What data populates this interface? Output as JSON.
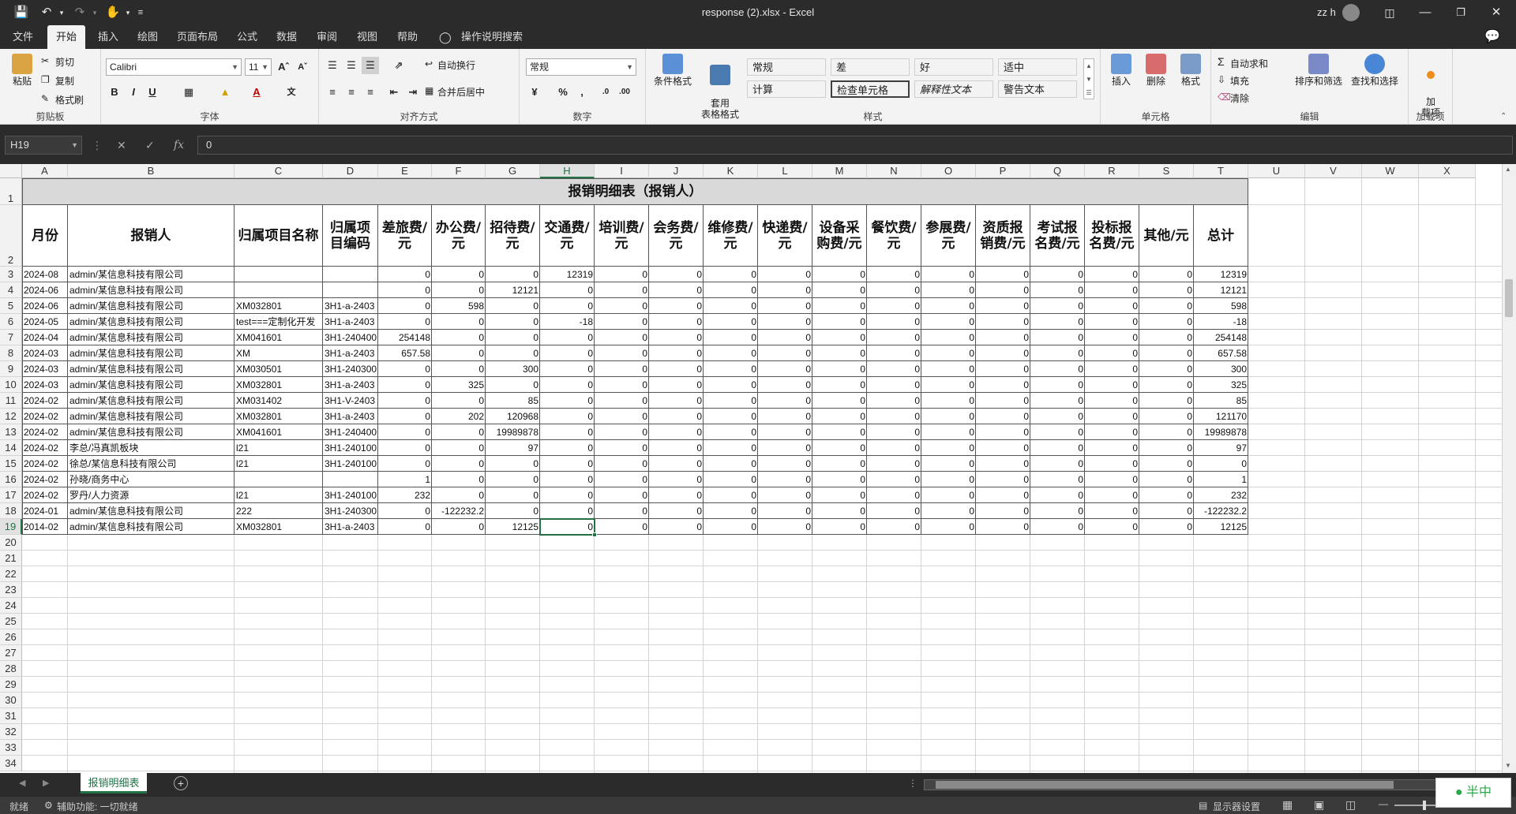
{
  "titlebar": {
    "doc_title": "response (2).xlsx  -  Excel",
    "user": "zz h"
  },
  "tabs": [
    "文件",
    "开始",
    "插入",
    "绘图",
    "页面布局",
    "公式",
    "数据",
    "审阅",
    "视图",
    "帮助"
  ],
  "tell_me": "操作说明搜索",
  "ribbon": {
    "clipboard": {
      "paste": "粘贴",
      "cut": "剪切",
      "copy": "复制",
      "format_painter": "格式刷",
      "label": "剪贴板"
    },
    "font": {
      "name": "Calibri",
      "size": "11",
      "label": "字体"
    },
    "alignment": {
      "wrap": "自动换行",
      "merge": "合并后居中",
      "label": "对齐方式"
    },
    "number": {
      "format": "常规",
      "label": "数字"
    },
    "styles": {
      "cond": "条件格式",
      "table": "套用\n表格格式",
      "label": "样式",
      "cells": [
        {
          "text": "常规",
          "bg": "#ffffff",
          "color": "#000000"
        },
        {
          "text": "差",
          "bg": "#ffc7ce",
          "color": "#9c0006"
        },
        {
          "text": "好",
          "bg": "#c6efce",
          "color": "#006100"
        },
        {
          "text": "适中",
          "bg": "#ffeb9c",
          "color": "#9c5700"
        },
        {
          "text": "计算",
          "bg": "#f2f2f2",
          "color": "#fa7d00"
        },
        {
          "text": "检查单元格",
          "bg": "#a5a5a5",
          "color": "#ffffff"
        },
        {
          "text": "解释性文本",
          "bg": "#ffffff",
          "color": "#7f7f7f"
        },
        {
          "text": "警告文本",
          "bg": "#ffffff",
          "color": "#ff0000"
        }
      ]
    },
    "cells": {
      "insert": "插入",
      "delete": "删除",
      "format": "格式",
      "label": "单元格"
    },
    "editing": {
      "autosum": "自动求和",
      "fill": "填充",
      "clear": "清除",
      "sort": "排序和筛选",
      "find": "查找和选择",
      "label": "编辑"
    },
    "addins": {
      "btn": "加\n载项",
      "label": "加载项"
    }
  },
  "formula_bar": {
    "name_box": "H19",
    "value": "0"
  },
  "columns": [
    "A",
    "B",
    "C",
    "D",
    "E",
    "F",
    "G",
    "H",
    "I",
    "J",
    "K",
    "L",
    "M",
    "N",
    "O",
    "P",
    "Q",
    "R",
    "S",
    "T",
    "U",
    "V",
    "W",
    "X"
  ],
  "sheet": {
    "title": "报销明细表（报销人）",
    "headers": [
      "月份",
      "报销人",
      "归属项目名称",
      "归属项目编码",
      "差旅费/元",
      "办公费/元",
      "招待费/元",
      "交通费/元",
      "培训费/元",
      "会务费/元",
      "维修费/元",
      "快递费/元",
      "设备采购费/元",
      "餐饮费/元",
      "参展费/元",
      "资质报销费/元",
      "考试报名费/元",
      "投标报名费/元",
      "其他/元",
      "总计"
    ],
    "rows": [
      [
        "2024-08",
        "admin/某信息科技有限公司",
        "",
        "",
        "0",
        "0",
        "0",
        "12319",
        "0",
        "0",
        "0",
        "0",
        "0",
        "0",
        "0",
        "0",
        "0",
        "0",
        "0",
        "12319"
      ],
      [
        "2024-06",
        "admin/某信息科技有限公司",
        "",
        "",
        "0",
        "0",
        "12121",
        "0",
        "0",
        "0",
        "0",
        "0",
        "0",
        "0",
        "0",
        "0",
        "0",
        "0",
        "0",
        "12121"
      ],
      [
        "2024-06",
        "admin/某信息科技有限公司",
        "XM032801",
        "3H1-a-2403",
        "0",
        "598",
        "0",
        "0",
        "0",
        "0",
        "0",
        "0",
        "0",
        "0",
        "0",
        "0",
        "0",
        "0",
        "0",
        "598"
      ],
      [
        "2024-05",
        "admin/某信息科技有限公司",
        "test===定制化开发",
        "3H1-a-2403",
        "0",
        "0",
        "0",
        "-18",
        "0",
        "0",
        "0",
        "0",
        "0",
        "0",
        "0",
        "0",
        "0",
        "0",
        "0",
        "-18"
      ],
      [
        "2024-04",
        "admin/某信息科技有限公司",
        "XM041601",
        "3H1-240400",
        "254148",
        "0",
        "0",
        "0",
        "0",
        "0",
        "0",
        "0",
        "0",
        "0",
        "0",
        "0",
        "0",
        "0",
        "0",
        "254148"
      ],
      [
        "2024-03",
        "admin/某信息科技有限公司",
        "XM",
        "3H1-a-2403",
        "657.58",
        "0",
        "0",
        "0",
        "0",
        "0",
        "0",
        "0",
        "0",
        "0",
        "0",
        "0",
        "0",
        "0",
        "0",
        "657.58"
      ],
      [
        "2024-03",
        "admin/某信息科技有限公司",
        "XM030501",
        "3H1-240300",
        "0",
        "0",
        "300",
        "0",
        "0",
        "0",
        "0",
        "0",
        "0",
        "0",
        "0",
        "0",
        "0",
        "0",
        "0",
        "300"
      ],
      [
        "2024-03",
        "admin/某信息科技有限公司",
        "XM032801",
        "3H1-a-2403",
        "0",
        "325",
        "0",
        "0",
        "0",
        "0",
        "0",
        "0",
        "0",
        "0",
        "0",
        "0",
        "0",
        "0",
        "0",
        "325"
      ],
      [
        "2024-02",
        "admin/某信息科技有限公司",
        "XM031402",
        "3H1-V-2403",
        "0",
        "0",
        "85",
        "0",
        "0",
        "0",
        "0",
        "0",
        "0",
        "0",
        "0",
        "0",
        "0",
        "0",
        "0",
        "85"
      ],
      [
        "2024-02",
        "admin/某信息科技有限公司",
        "XM032801",
        "3H1-a-2403",
        "0",
        "202",
        "120968",
        "0",
        "0",
        "0",
        "0",
        "0",
        "0",
        "0",
        "0",
        "0",
        "0",
        "0",
        "0",
        "121170"
      ],
      [
        "2024-02",
        "admin/某信息科技有限公司",
        "XM041601",
        "3H1-240400",
        "0",
        "0",
        "19989878",
        "0",
        "0",
        "0",
        "0",
        "0",
        "0",
        "0",
        "0",
        "0",
        "0",
        "0",
        "0",
        "19989878"
      ],
      [
        "2024-02",
        "李总/冯真凯板块",
        "l21",
        "3H1-240100",
        "0",
        "0",
        "97",
        "0",
        "0",
        "0",
        "0",
        "0",
        "0",
        "0",
        "0",
        "0",
        "0",
        "0",
        "0",
        "97"
      ],
      [
        "2024-02",
        "徐总/某信息科技有限公司",
        "l21",
        "3H1-240100",
        "0",
        "0",
        "0",
        "0",
        "0",
        "0",
        "0",
        "0",
        "0",
        "0",
        "0",
        "0",
        "0",
        "0",
        "0",
        "0"
      ],
      [
        "2024-02",
        "孙晓/商务中心",
        "",
        "",
        "1",
        "0",
        "0",
        "0",
        "0",
        "0",
        "0",
        "0",
        "0",
        "0",
        "0",
        "0",
        "0",
        "0",
        "0",
        "1"
      ],
      [
        "2024-02",
        "罗丹/人力资源",
        "l21",
        "3H1-240100",
        "232",
        "0",
        "0",
        "0",
        "0",
        "0",
        "0",
        "0",
        "0",
        "0",
        "0",
        "0",
        "0",
        "0",
        "0",
        "232"
      ],
      [
        "2024-01",
        "admin/某信息科技有限公司",
        "222",
        "3H1-240300",
        "0",
        "-122232.2",
        "0",
        "0",
        "0",
        "0",
        "0",
        "0",
        "0",
        "0",
        "0",
        "0",
        "0",
        "0",
        "0",
        "-122232.2"
      ],
      [
        "2014-02",
        "admin/某信息科技有限公司",
        "XM032801",
        "3H1-a-2403",
        "0",
        "0",
        "12125",
        "0",
        "0",
        "0",
        "0",
        "0",
        "0",
        "0",
        "0",
        "0",
        "0",
        "0",
        "0",
        "12125"
      ]
    ]
  },
  "sheet_tab": "报销明细表",
  "status": {
    "mode": "就绪",
    "accessibility": "辅助功能: 一切就绪",
    "display": "显示器设置"
  },
  "watermark": "半中"
}
